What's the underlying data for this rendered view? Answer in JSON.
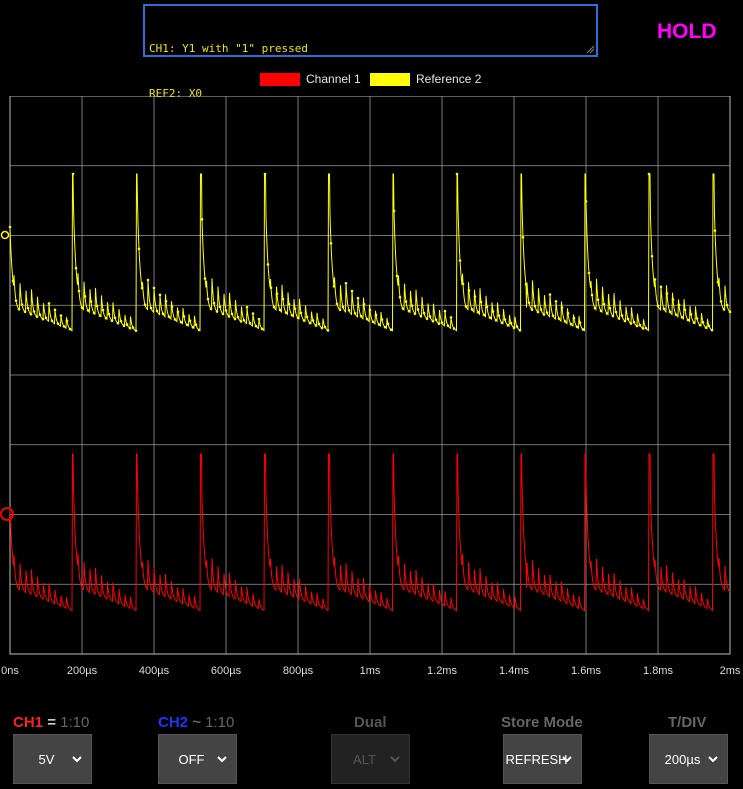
{
  "notes": {
    "line1": "CH1: Y1 with \"1\" pressed",
    "line2": "REF2: X0"
  },
  "status": "HOLD",
  "legend": [
    {
      "label": "Channel 1",
      "color": "#ff0000"
    },
    {
      "label": "Reference 2",
      "color": "#ffff00"
    }
  ],
  "chart_data": {
    "type": "line",
    "x_unit": "time",
    "xlim": [
      "0ns",
      "2ms"
    ],
    "x_tick_labels": [
      "0ns",
      "200µs",
      "400µs",
      "600µs",
      "800µs",
      "1ms",
      "1.2ms",
      "1.4ms",
      "1.6ms",
      "1.8ms",
      "2ms"
    ],
    "grid": true,
    "legend_position": "top-center",
    "period_us": 178,
    "series": [
      {
        "name": "Channel 1",
        "color": "#ff0000",
        "markers": false
      },
      {
        "name": "Reference 2",
        "color": "#ffff00",
        "markers": true
      }
    ]
  },
  "controls": {
    "ch1": {
      "name": "CH1",
      "coupling": "=",
      "probe": "1:10",
      "value": "5V",
      "color": "#ff0000"
    },
    "ch2": {
      "name": "CH2",
      "coupling": "~",
      "probe": "1:10",
      "value": "OFF",
      "color": "#1a1aff"
    },
    "dual": {
      "label": "Dual",
      "value": "ALT"
    },
    "store_mode": {
      "label": "Store Mode",
      "value": "REFRESH"
    },
    "tdiv": {
      "label": "T/DIV",
      "value": "200µs"
    }
  }
}
